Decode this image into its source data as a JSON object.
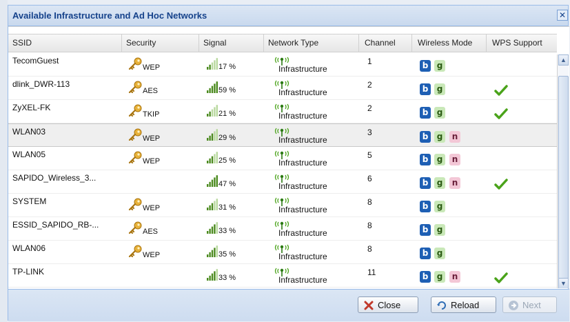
{
  "dialog": {
    "title": "Available Infrastructure and Ad Hoc Networks",
    "close_glyph": "✕"
  },
  "columns": {
    "ssid": "SSID",
    "security": "Security",
    "signal": "Signal",
    "network_type": "Network Type",
    "channel": "Channel",
    "wireless_mode": "Wireless Mode",
    "wps_support": "WPS Support"
  },
  "networks": [
    {
      "ssid": "TecomGuest",
      "security": "WEP",
      "signal": "17 %",
      "signal_level": 0.17,
      "type": "Infrastructure",
      "channel": "1",
      "modes": [
        "b",
        "g"
      ],
      "wps": false
    },
    {
      "ssid": "dlink_DWR-113",
      "security": "AES",
      "signal": "59 %",
      "signal_level": 0.59,
      "type": "Infrastructure",
      "channel": "2",
      "modes": [
        "b",
        "g"
      ],
      "wps": true
    },
    {
      "ssid": "ZyXEL-FK",
      "security": "TKIP",
      "signal": "21 %",
      "signal_level": 0.21,
      "type": "Infrastructure",
      "channel": "2",
      "modes": [
        "b",
        "g"
      ],
      "wps": true
    },
    {
      "ssid": "WLAN03",
      "security": "WEP",
      "signal": "29 %",
      "signal_level": 0.29,
      "type": "Infrastructure",
      "channel": "3",
      "modes": [
        "b",
        "g",
        "n"
      ],
      "wps": false,
      "selected": true
    },
    {
      "ssid": "WLAN05",
      "security": "WEP",
      "signal": "25 %",
      "signal_level": 0.25,
      "type": "Infrastructure",
      "channel": "5",
      "modes": [
        "b",
        "g",
        "n"
      ],
      "wps": false
    },
    {
      "ssid": "SAPIDO_Wireless_3...",
      "security": "",
      "signal": "47 %",
      "signal_level": 0.47,
      "type": "Infrastructure",
      "channel": "6",
      "modes": [
        "b",
        "g",
        "n"
      ],
      "wps": true
    },
    {
      "ssid": "SYSTEM",
      "security": "WEP",
      "signal": "31 %",
      "signal_level": 0.31,
      "type": "Infrastructure",
      "channel": "8",
      "modes": [
        "b",
        "g"
      ],
      "wps": false
    },
    {
      "ssid": "ESSID_SAPIDO_RB-...",
      "security": "AES",
      "signal": "33 %",
      "signal_level": 0.33,
      "type": "Infrastructure",
      "channel": "8",
      "modes": [
        "b",
        "g"
      ],
      "wps": false
    },
    {
      "ssid": "WLAN06",
      "security": "WEP",
      "signal": "35 %",
      "signal_level": 0.35,
      "type": "Infrastructure",
      "channel": "8",
      "modes": [
        "b",
        "g"
      ],
      "wps": false
    },
    {
      "ssid": "TP-LINK",
      "security": "",
      "signal": "33 %",
      "signal_level": 0.33,
      "type": "Infrastructure",
      "channel": "11",
      "modes": [
        "b",
        "g",
        "n"
      ],
      "wps": true
    }
  ],
  "footer": {
    "close_label": "Close",
    "reload_label": "Reload",
    "next_label": "Next"
  },
  "icons": {
    "security": "key-icon",
    "signal": "signal-bars-icon",
    "network_type": "antenna-icon",
    "wps": "checkmark-icon",
    "close": "close-x-icon",
    "reload": "reload-icon",
    "next": "next-arrow-icon"
  },
  "colors": {
    "title_text": "#15428b",
    "badge_b": "#1e5fb4",
    "badge_g": "#c9e8b8",
    "badge_n": "#f3c7d6",
    "check": "#4aa31a",
    "key": "#e0a420"
  }
}
